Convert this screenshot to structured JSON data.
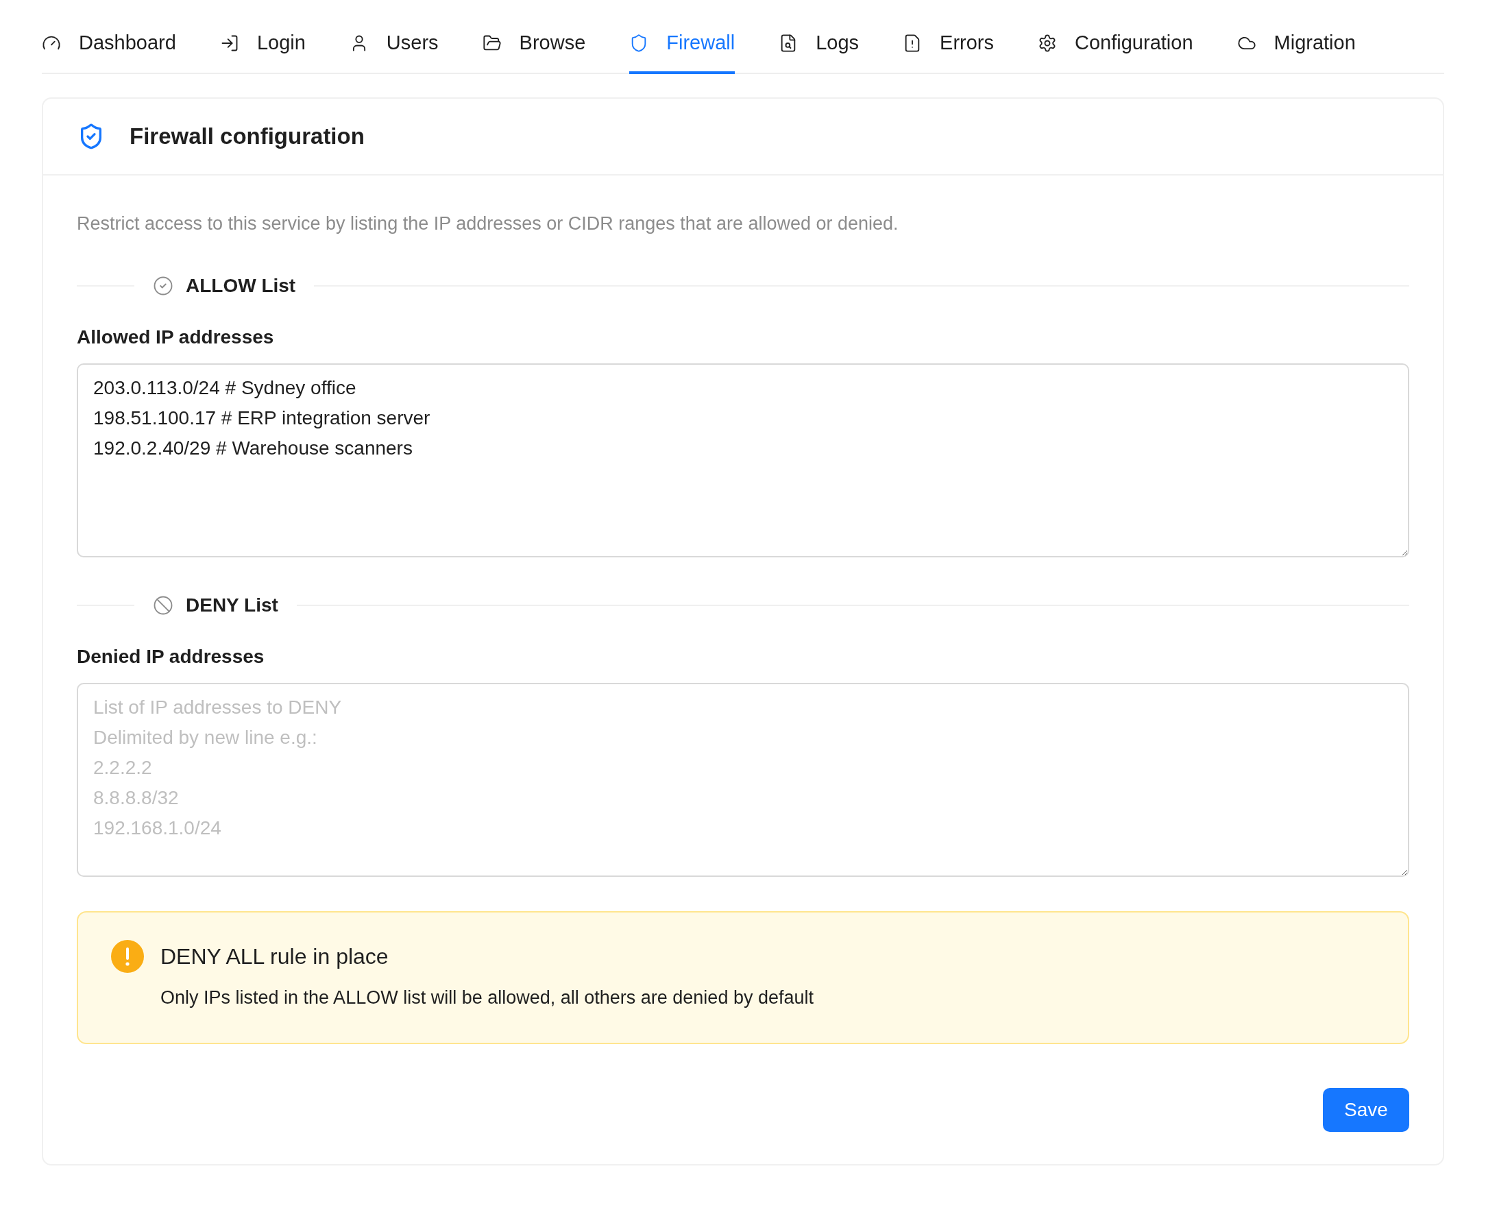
{
  "tabs": [
    {
      "label": "Dashboard",
      "selected": false
    },
    {
      "label": "Login",
      "selected": false
    },
    {
      "label": "Users",
      "selected": false
    },
    {
      "label": "Browse",
      "selected": false
    },
    {
      "label": "Firewall",
      "selected": true
    },
    {
      "label": "Logs",
      "selected": false
    },
    {
      "label": "Errors",
      "selected": false
    },
    {
      "label": "Configuration",
      "selected": false
    },
    {
      "label": "Migration",
      "selected": false
    }
  ],
  "card": {
    "title": "Firewall configuration",
    "description": "Restrict access to this service by listing the IP addresses or CIDR ranges that are allowed or denied.",
    "sections": [
      {
        "kind": "allow",
        "heading": "ALLOW List",
        "label": "Allowed IP addresses",
        "value": "203.0.113.0/24 # Sydney office\n198.51.100.17 # ERP integration server\n192.0.2.40/29 # Warehouse scanners"
      },
      {
        "kind": "deny",
        "heading": "DENY List",
        "label": "Denied IP addresses",
        "placeholder": "List of IP addresses to DENY\nDelimited by new line e.g.:\n2.2.2.2\n8.8.8.8/32\n192.168.1.0/24"
      }
    ],
    "alert": {
      "title": "DENY ALL rule in place",
      "message": "Only IPs listed in the ALLOW list will be allowed, all others are denied by default"
    },
    "save_button": "Save"
  }
}
